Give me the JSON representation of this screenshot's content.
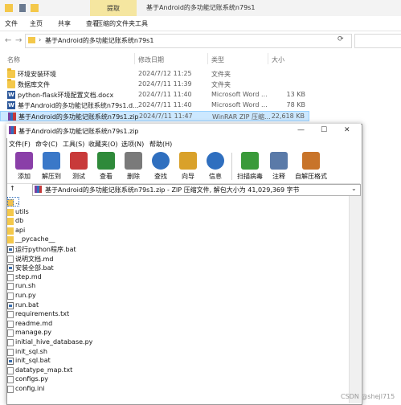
{
  "explorer": {
    "ribbon_context_tab": "提取",
    "window_title": "基于Android的多功能记账系统n79s1",
    "tabs": [
      "文件",
      "主页",
      "共享",
      "查看",
      "压缩的文件夹工具"
    ],
    "address": "基于Android的多功能记账系统n79s1",
    "columns": {
      "name": "名称",
      "date": "修改日期",
      "type": "类型",
      "size": "大小"
    },
    "files": [
      {
        "name": "环境安装环境",
        "date": "2024/7/12 11:25",
        "type": "文件夹",
        "size": "",
        "icon": "folder-icon"
      },
      {
        "name": "数据库文件",
        "date": "2024/7/11 11:39",
        "type": "文件夹",
        "size": "",
        "icon": "folder-icon"
      },
      {
        "name": "python-flask环境配置文档.docx",
        "date": "2024/7/11 11:40",
        "type": "Microsoft Word ...",
        "size": "13 KB",
        "icon": "word-icon"
      },
      {
        "name": "基于Android的多功能记账系统n79s1.d...",
        "date": "2024/7/11 11:40",
        "type": "Microsoft Word ...",
        "size": "78 KB",
        "icon": "word-icon"
      },
      {
        "name": "基于Android的多功能记账系统n79s1.zip",
        "date": "2024/7/11 11:47",
        "type": "WinRAR ZIP 压缩...",
        "size": "22,618 KB",
        "icon": "zip-icon",
        "selected": true
      }
    ]
  },
  "winrar": {
    "title": "基于Android的多功能记账系统n79s1.zip",
    "menu": [
      "文件(F)",
      "命令(C)",
      "工具(S)",
      "收藏夹(O)",
      "选项(N)",
      "帮助(H)"
    ],
    "toolbar": [
      {
        "label": "添加",
        "icon": "add-icon",
        "color": "#8a3fa8"
      },
      {
        "label": "解压到",
        "icon": "extract-to-icon",
        "color": "#3a78c8"
      },
      {
        "label": "测试",
        "icon": "test-icon",
        "color": "#c83a3a"
      },
      {
        "label": "查看",
        "icon": "view-icon",
        "color": "#2f8a3a"
      },
      {
        "label": "删除",
        "icon": "delete-icon",
        "color": "#7a7a7a"
      },
      {
        "label": "查找",
        "icon": "find-icon",
        "color": "#2f6fbf"
      },
      {
        "label": "向导",
        "icon": "wizard-icon",
        "color": "#d9a12a"
      },
      {
        "label": "信息",
        "icon": "info-icon",
        "color": "#2f6fbf"
      },
      {
        "label": "扫描病毒",
        "icon": "virus-scan-icon",
        "color": "#3a9a3a"
      },
      {
        "label": "注释",
        "icon": "comment-icon",
        "color": "#5a7aa8"
      },
      {
        "label": "自解压格式",
        "icon": "sfx-icon",
        "color": "#c8742a"
      }
    ],
    "up_label": "↑",
    "path_text": "基于Android的多功能记账系统n79s1.zip - ZIP 压缩文件, 解包大小为 41,029,369 字节",
    "items": [
      {
        "name": "..",
        "kind": "parent"
      },
      {
        "name": "utils",
        "kind": "folder"
      },
      {
        "name": "db",
        "kind": "folder"
      },
      {
        "name": "api",
        "kind": "folder"
      },
      {
        "name": "__pycache__",
        "kind": "folder"
      },
      {
        "name": "运行python程序.bat",
        "kind": "bat"
      },
      {
        "name": "说明文档.md",
        "kind": "file"
      },
      {
        "name": "安装全部.bat",
        "kind": "bat"
      },
      {
        "name": "step.md",
        "kind": "file"
      },
      {
        "name": "run.sh",
        "kind": "file"
      },
      {
        "name": "run.py",
        "kind": "file"
      },
      {
        "name": "run.bat",
        "kind": "bat"
      },
      {
        "name": "requirements.txt",
        "kind": "file"
      },
      {
        "name": "readme.md",
        "kind": "file"
      },
      {
        "name": "manage.py",
        "kind": "file"
      },
      {
        "name": "initial_hive_database.py",
        "kind": "file"
      },
      {
        "name": "init_sql.sh",
        "kind": "file"
      },
      {
        "name": "init_sql.bat",
        "kind": "bat"
      },
      {
        "name": "datatype_map.txt",
        "kind": "file"
      },
      {
        "name": "configs.py",
        "kind": "file"
      },
      {
        "name": "config.ini",
        "kind": "file"
      }
    ]
  },
  "watermark": "CSDN @shejl715"
}
